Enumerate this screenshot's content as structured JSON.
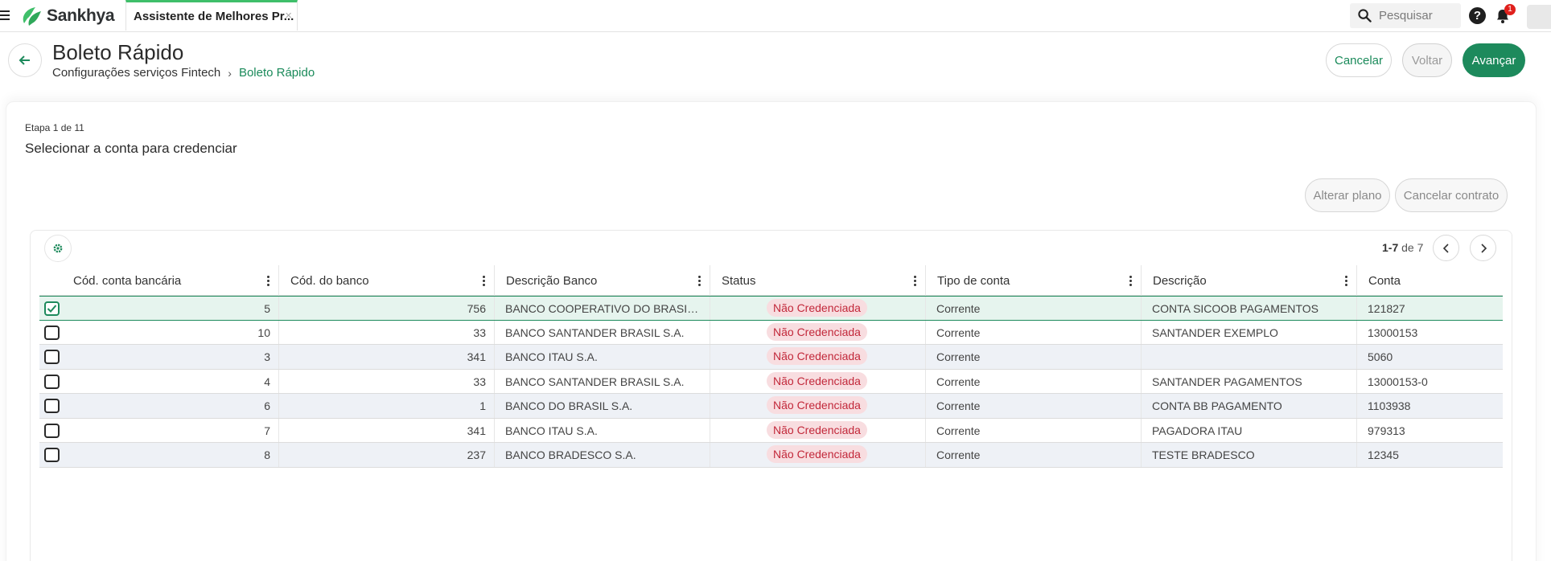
{
  "app": {
    "brand": "Sankhya"
  },
  "tab": {
    "label": "Assistente de Melhores Pr...",
    "close": "×"
  },
  "search": {
    "placeholder": "Pesquisar"
  },
  "topbar": {
    "help": "?",
    "notifications_count": "1"
  },
  "header": {
    "title": "Boleto Rápido",
    "breadcrumb": [
      "Configurações serviços Fintech",
      "Boleto Rápido"
    ],
    "buttons": {
      "cancel": "Cancelar",
      "back": "Voltar",
      "next": "Avançar"
    }
  },
  "step": {
    "label": "Etapa 1 de 11",
    "title": "Selecionar a conta para credenciar"
  },
  "actions": {
    "change_plan": "Alterar plano",
    "cancel_contract": "Cancelar contrato"
  },
  "pager": {
    "range": "1-7",
    "of": "de 7"
  },
  "table": {
    "columns": [
      "Cód. conta bancária",
      "Cód. do banco",
      "Descrição Banco",
      "Status",
      "Tipo de conta",
      "Descrição",
      "Conta"
    ],
    "rows": [
      {
        "selected": true,
        "cod_conta": "5",
        "cod_banco": "756",
        "descricao_banco": "BANCO COOPERATIVO DO BRASIL S.A.",
        "status": "Não Credenciada",
        "tipo": "Corrente",
        "descricao": "CONTA SICOOB PAGAMENTOS",
        "conta": "121827"
      },
      {
        "selected": false,
        "cod_conta": "10",
        "cod_banco": "33",
        "descricao_banco": "BANCO SANTANDER BRASIL S.A.",
        "status": "Não Credenciada",
        "tipo": "Corrente",
        "descricao": "SANTANDER EXEMPLO",
        "conta": "13000153"
      },
      {
        "selected": false,
        "cod_conta": "3",
        "cod_banco": "341",
        "descricao_banco": "BANCO ITAU S.A.",
        "status": "Não Credenciada",
        "tipo": "Corrente",
        "descricao": "",
        "conta": "5060"
      },
      {
        "selected": false,
        "cod_conta": "4",
        "cod_banco": "33",
        "descricao_banco": "BANCO SANTANDER BRASIL S.A.",
        "status": "Não Credenciada",
        "tipo": "Corrente",
        "descricao": "SANTANDER PAGAMENTOS",
        "conta": "13000153-0"
      },
      {
        "selected": false,
        "cod_conta": "6",
        "cod_banco": "1",
        "descricao_banco": "BANCO DO BRASIL S.A.",
        "status": "Não Credenciada",
        "tipo": "Corrente",
        "descricao": "CONTA BB PAGAMENTO",
        "conta": "1103938"
      },
      {
        "selected": false,
        "cod_conta": "7",
        "cod_banco": "341",
        "descricao_banco": "BANCO ITAU S.A.",
        "status": "Não Credenciada",
        "tipo": "Corrente",
        "descricao": "PAGADORA ITAU",
        "conta": "979313"
      },
      {
        "selected": false,
        "cod_conta": "8",
        "cod_banco": "237",
        "descricao_banco": "BANCO BRADESCO S.A.",
        "status": "Não Credenciada",
        "tipo": "Corrente",
        "descricao": "TESTE BRADESCO",
        "conta": "12345"
      }
    ]
  },
  "colors": {
    "accent": "#1d8a5c",
    "brand_green": "#3fbf6a",
    "status_bg": "#f8dde0",
    "status_text": "#c2283a",
    "alt_row": "#eef1f6"
  }
}
